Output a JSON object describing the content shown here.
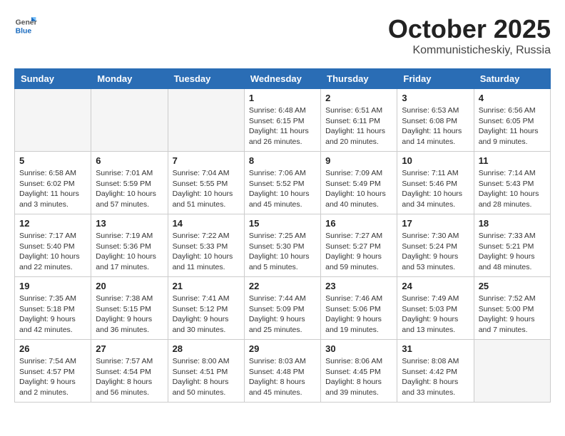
{
  "header": {
    "logo_general": "General",
    "logo_blue": "Blue",
    "month_title": "October 2025",
    "location": "Kommunisticheskiy, Russia"
  },
  "days_of_week": [
    "Sunday",
    "Monday",
    "Tuesday",
    "Wednesday",
    "Thursday",
    "Friday",
    "Saturday"
  ],
  "weeks": [
    [
      {
        "num": "",
        "info": ""
      },
      {
        "num": "",
        "info": ""
      },
      {
        "num": "",
        "info": ""
      },
      {
        "num": "1",
        "info": "Sunrise: 6:48 AM\nSunset: 6:15 PM\nDaylight: 11 hours\nand 26 minutes."
      },
      {
        "num": "2",
        "info": "Sunrise: 6:51 AM\nSunset: 6:11 PM\nDaylight: 11 hours\nand 20 minutes."
      },
      {
        "num": "3",
        "info": "Sunrise: 6:53 AM\nSunset: 6:08 PM\nDaylight: 11 hours\nand 14 minutes."
      },
      {
        "num": "4",
        "info": "Sunrise: 6:56 AM\nSunset: 6:05 PM\nDaylight: 11 hours\nand 9 minutes."
      }
    ],
    [
      {
        "num": "5",
        "info": "Sunrise: 6:58 AM\nSunset: 6:02 PM\nDaylight: 11 hours\nand 3 minutes."
      },
      {
        "num": "6",
        "info": "Sunrise: 7:01 AM\nSunset: 5:59 PM\nDaylight: 10 hours\nand 57 minutes."
      },
      {
        "num": "7",
        "info": "Sunrise: 7:04 AM\nSunset: 5:55 PM\nDaylight: 10 hours\nand 51 minutes."
      },
      {
        "num": "8",
        "info": "Sunrise: 7:06 AM\nSunset: 5:52 PM\nDaylight: 10 hours\nand 45 minutes."
      },
      {
        "num": "9",
        "info": "Sunrise: 7:09 AM\nSunset: 5:49 PM\nDaylight: 10 hours\nand 40 minutes."
      },
      {
        "num": "10",
        "info": "Sunrise: 7:11 AM\nSunset: 5:46 PM\nDaylight: 10 hours\nand 34 minutes."
      },
      {
        "num": "11",
        "info": "Sunrise: 7:14 AM\nSunset: 5:43 PM\nDaylight: 10 hours\nand 28 minutes."
      }
    ],
    [
      {
        "num": "12",
        "info": "Sunrise: 7:17 AM\nSunset: 5:40 PM\nDaylight: 10 hours\nand 22 minutes."
      },
      {
        "num": "13",
        "info": "Sunrise: 7:19 AM\nSunset: 5:36 PM\nDaylight: 10 hours\nand 17 minutes."
      },
      {
        "num": "14",
        "info": "Sunrise: 7:22 AM\nSunset: 5:33 PM\nDaylight: 10 hours\nand 11 minutes."
      },
      {
        "num": "15",
        "info": "Sunrise: 7:25 AM\nSunset: 5:30 PM\nDaylight: 10 hours\nand 5 minutes."
      },
      {
        "num": "16",
        "info": "Sunrise: 7:27 AM\nSunset: 5:27 PM\nDaylight: 9 hours\nand 59 minutes."
      },
      {
        "num": "17",
        "info": "Sunrise: 7:30 AM\nSunset: 5:24 PM\nDaylight: 9 hours\nand 53 minutes."
      },
      {
        "num": "18",
        "info": "Sunrise: 7:33 AM\nSunset: 5:21 PM\nDaylight: 9 hours\nand 48 minutes."
      }
    ],
    [
      {
        "num": "19",
        "info": "Sunrise: 7:35 AM\nSunset: 5:18 PM\nDaylight: 9 hours\nand 42 minutes."
      },
      {
        "num": "20",
        "info": "Sunrise: 7:38 AM\nSunset: 5:15 PM\nDaylight: 9 hours\nand 36 minutes."
      },
      {
        "num": "21",
        "info": "Sunrise: 7:41 AM\nSunset: 5:12 PM\nDaylight: 9 hours\nand 30 minutes."
      },
      {
        "num": "22",
        "info": "Sunrise: 7:44 AM\nSunset: 5:09 PM\nDaylight: 9 hours\nand 25 minutes."
      },
      {
        "num": "23",
        "info": "Sunrise: 7:46 AM\nSunset: 5:06 PM\nDaylight: 9 hours\nand 19 minutes."
      },
      {
        "num": "24",
        "info": "Sunrise: 7:49 AM\nSunset: 5:03 PM\nDaylight: 9 hours\nand 13 minutes."
      },
      {
        "num": "25",
        "info": "Sunrise: 7:52 AM\nSunset: 5:00 PM\nDaylight: 9 hours\nand 7 minutes."
      }
    ],
    [
      {
        "num": "26",
        "info": "Sunrise: 7:54 AM\nSunset: 4:57 PM\nDaylight: 9 hours\nand 2 minutes."
      },
      {
        "num": "27",
        "info": "Sunrise: 7:57 AM\nSunset: 4:54 PM\nDaylight: 8 hours\nand 56 minutes."
      },
      {
        "num": "28",
        "info": "Sunrise: 8:00 AM\nSunset: 4:51 PM\nDaylight: 8 hours\nand 50 minutes."
      },
      {
        "num": "29",
        "info": "Sunrise: 8:03 AM\nSunset: 4:48 PM\nDaylight: 8 hours\nand 45 minutes."
      },
      {
        "num": "30",
        "info": "Sunrise: 8:06 AM\nSunset: 4:45 PM\nDaylight: 8 hours\nand 39 minutes."
      },
      {
        "num": "31",
        "info": "Sunrise: 8:08 AM\nSunset: 4:42 PM\nDaylight: 8 hours\nand 33 minutes."
      },
      {
        "num": "",
        "info": ""
      }
    ]
  ]
}
